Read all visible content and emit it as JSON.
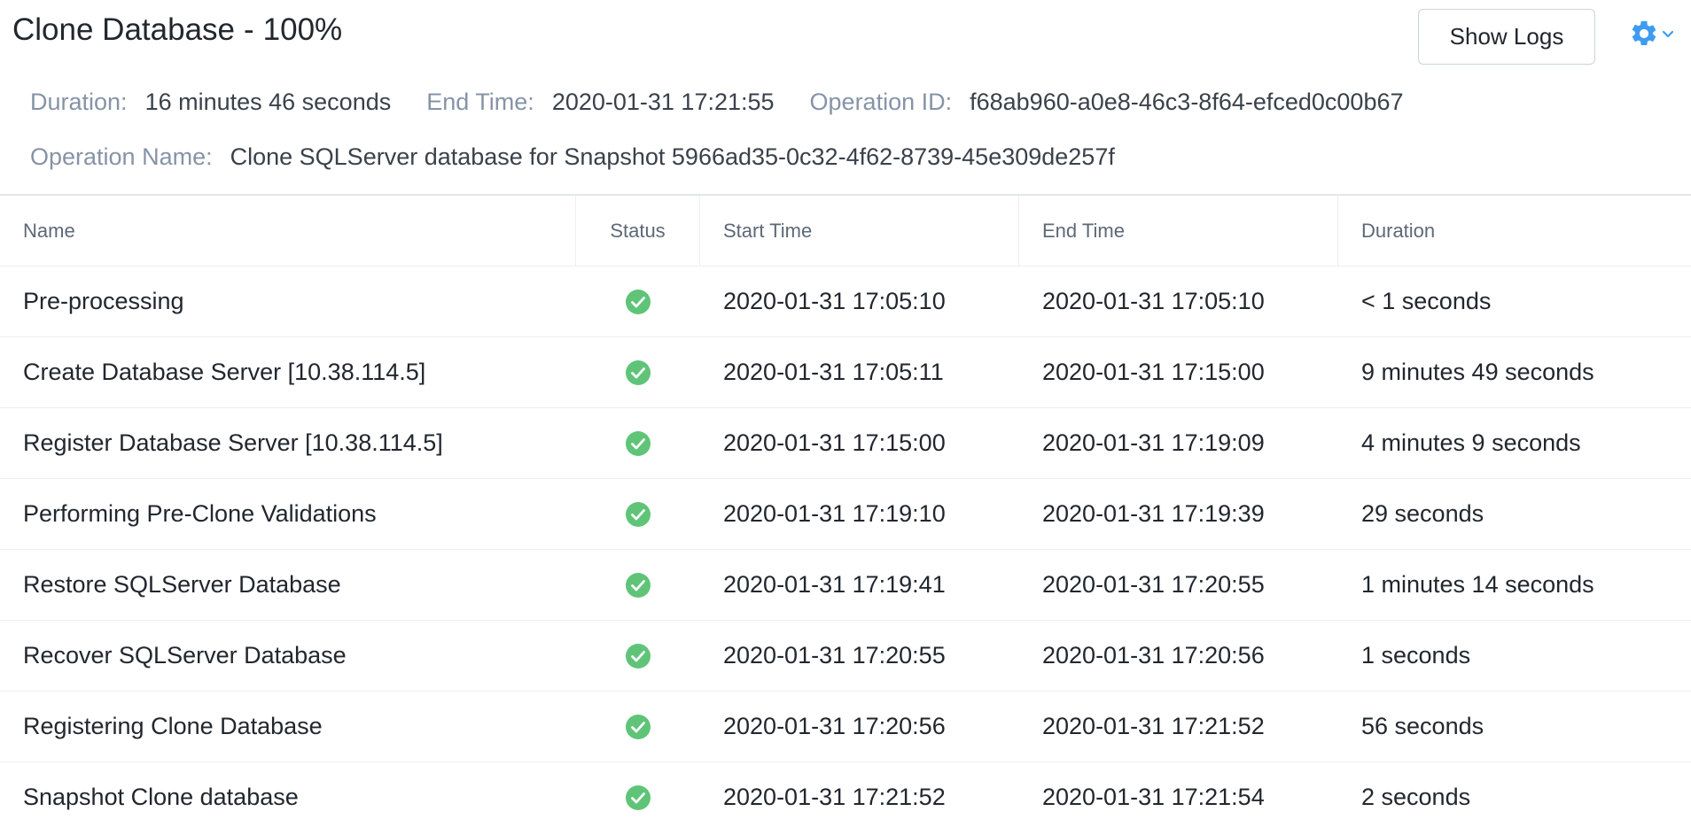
{
  "header": {
    "title": "Clone Database",
    "separator": "-",
    "progress": "100%",
    "show_logs_label": "Show Logs",
    "gear_icon": "gear-icon",
    "chevron_icon": "chevron-down-icon",
    "accent_color": "#3d9cf0"
  },
  "meta": {
    "duration_label": "Duration:",
    "duration_value": "16 minutes 46 seconds",
    "end_time_label": "End Time:",
    "end_time_value": "2020-01-31 17:21:55",
    "operation_id_label": "Operation ID:",
    "operation_id_value": "f68ab960-a0e8-46c3-8f64-efced0c00b67",
    "operation_name_label": "Operation Name:",
    "operation_name_value": "Clone SQLServer database for Snapshot 5966ad35-0c32-4f62-8739-45e309de257f"
  },
  "table": {
    "columns": [
      "Name",
      "Status",
      "Start Time",
      "End Time",
      "Duration"
    ],
    "status_icon": "check-circle-icon",
    "success_color": "#5fc478",
    "rows": [
      {
        "name": "Pre-processing",
        "status": "success",
        "start": "2020-01-31 17:05:10",
        "end": "2020-01-31 17:05:10",
        "duration": "< 1 seconds"
      },
      {
        "name": "Create Database Server [10.38.114.5]",
        "status": "success",
        "start": "2020-01-31 17:05:11",
        "end": "2020-01-31 17:15:00",
        "duration": "9 minutes 49 seconds"
      },
      {
        "name": "Register Database Server [10.38.114.5]",
        "status": "success",
        "start": "2020-01-31 17:15:00",
        "end": "2020-01-31 17:19:09",
        "duration": "4 minutes 9 seconds"
      },
      {
        "name": "Performing Pre-Clone Validations",
        "status": "success",
        "start": "2020-01-31 17:19:10",
        "end": "2020-01-31 17:19:39",
        "duration": "29 seconds"
      },
      {
        "name": "Restore SQLServer Database",
        "status": "success",
        "start": "2020-01-31 17:19:41",
        "end": "2020-01-31 17:20:55",
        "duration": "1 minutes 14 seconds"
      },
      {
        "name": "Recover SQLServer Database",
        "status": "success",
        "start": "2020-01-31 17:20:55",
        "end": "2020-01-31 17:20:56",
        "duration": "1 seconds"
      },
      {
        "name": "Registering Clone Database",
        "status": "success",
        "start": "2020-01-31 17:20:56",
        "end": "2020-01-31 17:21:52",
        "duration": "56 seconds"
      },
      {
        "name": "Snapshot Clone database",
        "status": "success",
        "start": "2020-01-31 17:21:52",
        "end": "2020-01-31 17:21:54",
        "duration": "2 seconds"
      }
    ]
  }
}
